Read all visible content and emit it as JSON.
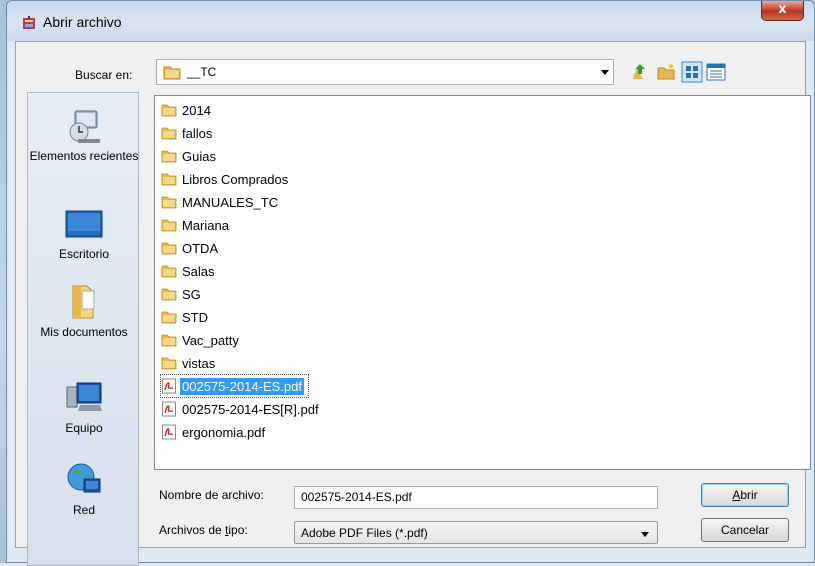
{
  "window": {
    "title": "Abrir archivo",
    "close_glyph": "x"
  },
  "lookin": {
    "label": "Buscar en:",
    "value": "__TC"
  },
  "toolbar": {
    "icons": [
      "up-folder-icon",
      "new-folder-icon",
      "view-menu-icon",
      "details-view-icon"
    ]
  },
  "places": [
    {
      "label": "Elementos recientes",
      "icon": "recent-items-icon"
    },
    {
      "label": "Escritorio",
      "icon": "desktop-icon"
    },
    {
      "label": "Mis documentos",
      "icon": "my-documents-icon"
    },
    {
      "label": "Equipo",
      "icon": "computer-icon"
    },
    {
      "label": "Red",
      "icon": "network-icon"
    }
  ],
  "files": [
    {
      "name": "2014",
      "type": "folder"
    },
    {
      "name": "fallos",
      "type": "folder"
    },
    {
      "name": "Guias",
      "type": "folder"
    },
    {
      "name": "Libros Comprados",
      "type": "folder"
    },
    {
      "name": "MANUALES_TC",
      "type": "folder"
    },
    {
      "name": "Mariana",
      "type": "folder"
    },
    {
      "name": "OTDA",
      "type": "folder"
    },
    {
      "name": "Salas",
      "type": "folder"
    },
    {
      "name": "SG",
      "type": "folder"
    },
    {
      "name": "STD",
      "type": "folder"
    },
    {
      "name": "Vac_patty",
      "type": "folder"
    },
    {
      "name": "vistas",
      "type": "folder"
    },
    {
      "name": "002575-2014-ES.pdf",
      "type": "pdf",
      "selected": true
    },
    {
      "name": "002575-2014-ES[R].pdf",
      "type": "pdf"
    },
    {
      "name": "ergonomia.pdf",
      "type": "pdf"
    }
  ],
  "filename": {
    "label_pre": "",
    "label": "Nombre de archivo:",
    "value": "002575-2014-ES.pdf"
  },
  "filetype": {
    "label_pre": "Archivos de ",
    "label_key": "t",
    "label_post": "ipo:",
    "value": "Adobe PDF Files (*.pdf)"
  },
  "buttons": {
    "open_key": "A",
    "open_rest": "brir",
    "cancel": "Cancelar"
  },
  "colors": {
    "selection": "#3399ff",
    "folder": "#e8b94a",
    "pdf_red": "#c8171e"
  }
}
